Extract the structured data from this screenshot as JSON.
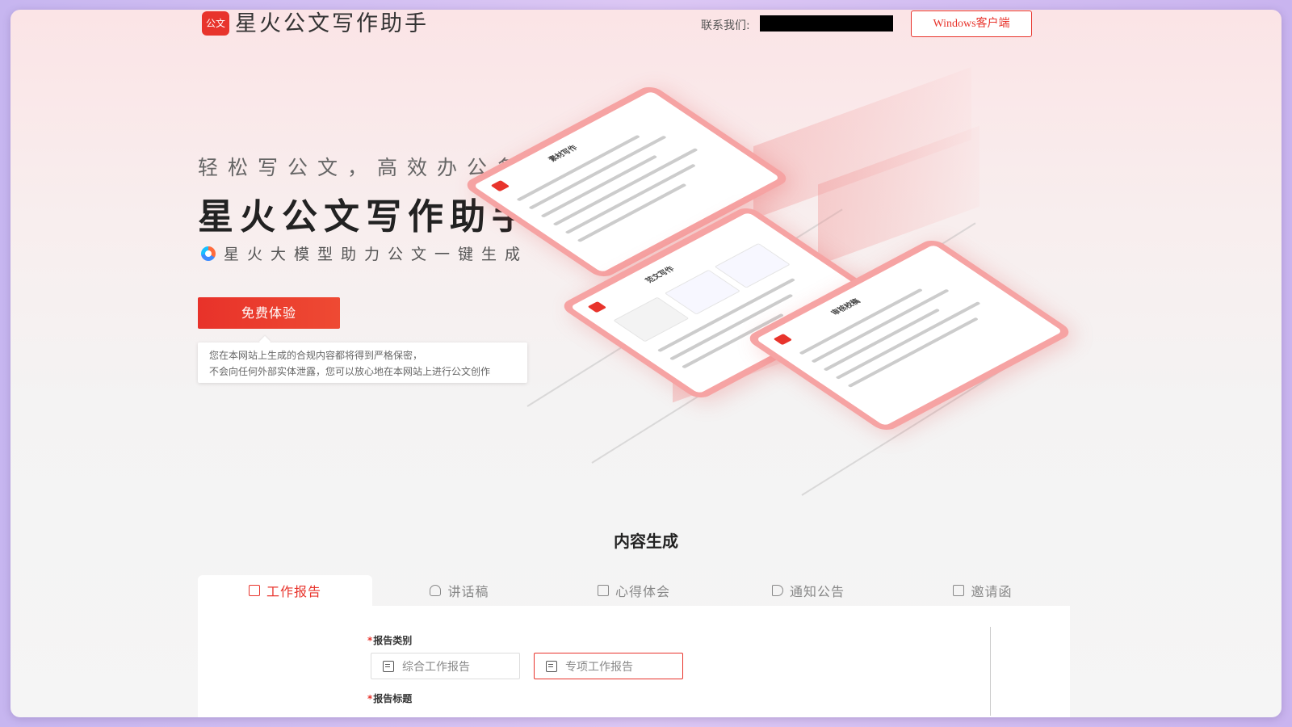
{
  "header": {
    "logo_badge": "公文",
    "app_name": "星火公文写作助手",
    "contact_label": "联系我们:",
    "windows_button": "Windows客户端"
  },
  "hero": {
    "slogan": "轻松写公文，高效办公务",
    "title": "星火公文写作助手",
    "tagline": "星火大模型助力公文一键生成",
    "cta": "免费体验",
    "privacy_line1": "您在本网站上生成的合规内容都将得到严格保密，",
    "privacy_line2": "不会向任何外部实体泄露，您可以放心地在本网站上进行公文创作"
  },
  "illustration": {
    "card1_title": "素材写作",
    "card2_title": "范文写作",
    "card3_title": "审核校稿"
  },
  "section": {
    "title": "内容生成",
    "tabs": [
      {
        "label": "工作报告",
        "icon": "report-icon",
        "active": true
      },
      {
        "label": "讲话稿",
        "icon": "speaker-person-icon",
        "active": false
      },
      {
        "label": "心得体会",
        "icon": "note-icon",
        "active": false
      },
      {
        "label": "通知公告",
        "icon": "megaphone-icon",
        "active": false
      },
      {
        "label": "邀请函",
        "icon": "envelope-icon",
        "active": false
      }
    ]
  },
  "form": {
    "report_type_label": "报告类别",
    "report_type_options": [
      {
        "label": "综合工作报告",
        "selected": false
      },
      {
        "label": "专项工作报告",
        "selected": true
      }
    ],
    "report_title_label": "报告标题"
  },
  "colors": {
    "accent": "#e8342c",
    "card_border": "#f6a3a3"
  }
}
